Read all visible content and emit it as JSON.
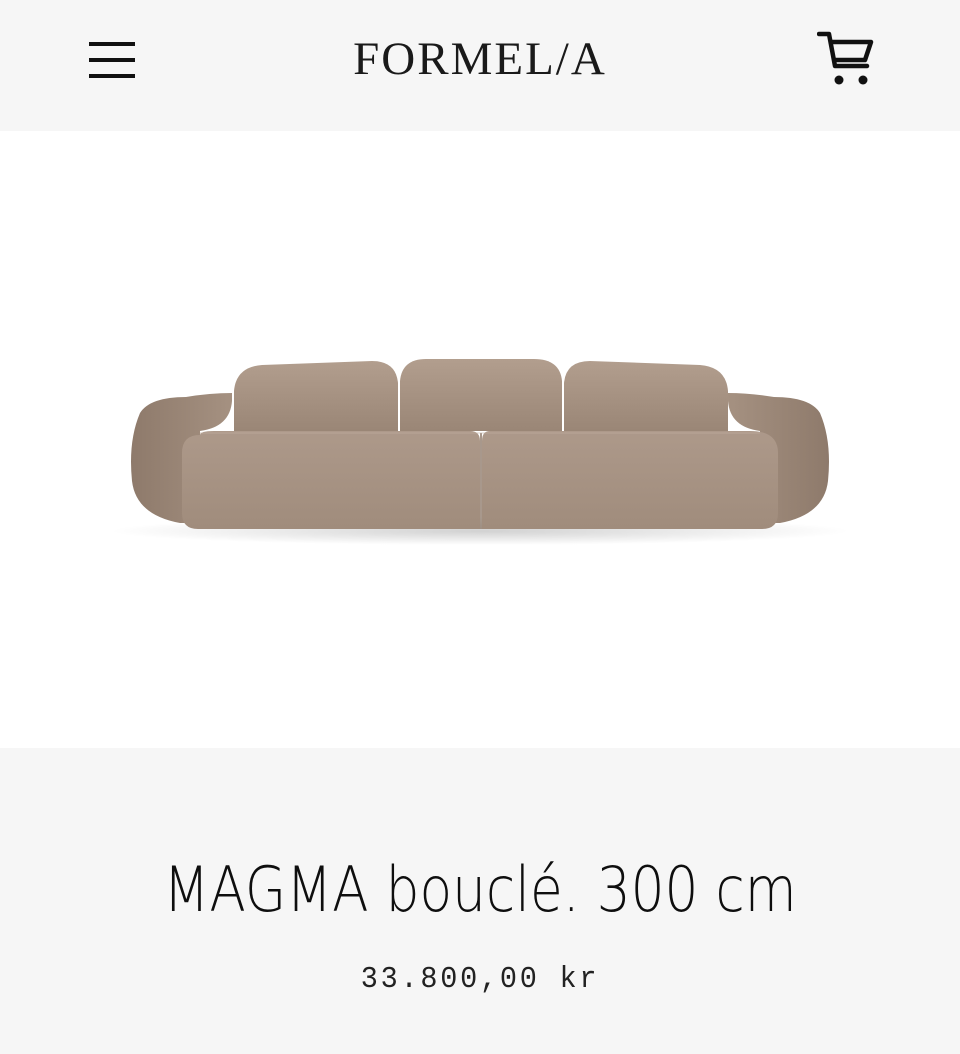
{
  "header": {
    "logo": "FORMEL/A",
    "menu_icon": "hamburger-menu-icon",
    "cart_icon": "shopping-cart-icon"
  },
  "product": {
    "image_alt": "sofa",
    "title": "MAGMA bouclé. 300 cm",
    "price": "33.800,00 kr",
    "color_hex": "#a89484"
  },
  "colors": {
    "header_bg": "#f6f6f6",
    "image_bg": "#ffffff",
    "text": "#111111"
  }
}
